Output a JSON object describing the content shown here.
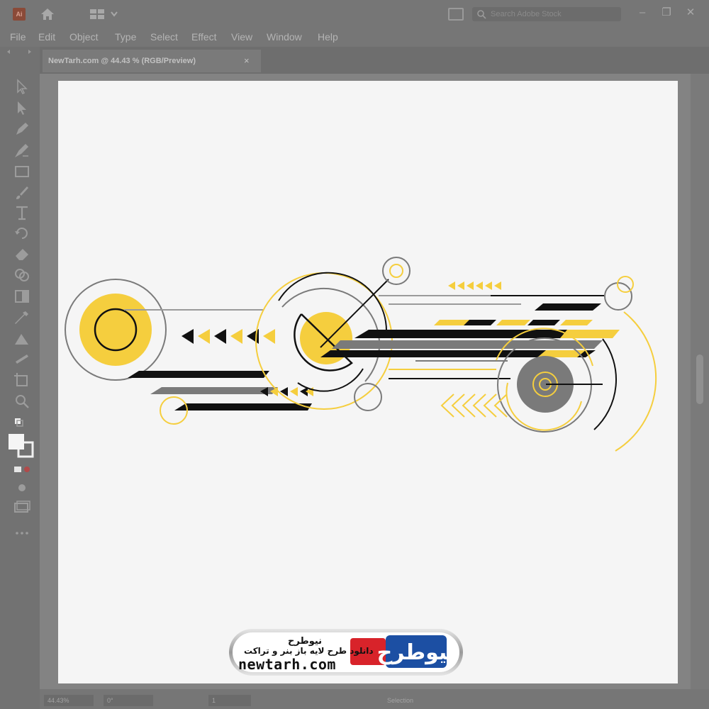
{
  "app": {
    "logo_text": "Ai",
    "search_placeholder": "Search Adobe Stock",
    "window_controls": [
      "–",
      "❐",
      "✕"
    ]
  },
  "menu": {
    "items": [
      "File",
      "Edit",
      "Object",
      "Type",
      "Select",
      "Effect",
      "View",
      "Window",
      "Help"
    ]
  },
  "document_tab": {
    "title": "NewTarh.com @ 44.43 % (RGB/Preview)",
    "close_label": "×"
  },
  "tools": [
    "selection-icon",
    "direct-selection-icon",
    "pen-icon",
    "curvature-icon",
    "rectangle-icon",
    "paintbrush-icon",
    "type-icon",
    "rotate-icon",
    "eraser-icon",
    "shape-builder-icon",
    "gradient-icon",
    "eyedropper-icon",
    "blend-icon",
    "width-icon",
    "artboard-icon",
    "zoom-icon",
    "fill-stroke-swatch",
    "drawing-modes-icon",
    "screen-mode-icon",
    "more-tools-icon"
  ],
  "status": {
    "zoom": "44.43%",
    "rotation": "0°",
    "artboard": "1",
    "mode": "Selection"
  },
  "colors": {
    "yellow": "#f5ce3e",
    "black": "#111111",
    "gray": "#7a7a7a",
    "light_gray": "#9a9a9a"
  },
  "watermark": {
    "logo_text": "نیوطرح",
    "name": "نیوطرح",
    "tagline": "دانلود طرح لایه باز بنر و تراکت",
    "domain": "newtarh.com"
  }
}
